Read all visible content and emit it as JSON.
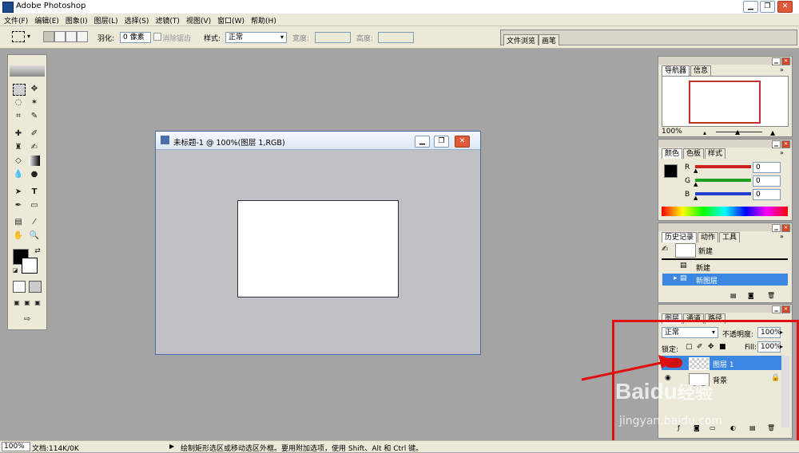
{
  "window": {
    "title": "Adobe Photoshop",
    "min": "▁",
    "max": "❐",
    "close": "✕"
  },
  "menu": [
    "文件(F)",
    "编辑(E)",
    "图象(I)",
    "图层(L)",
    "选择(S)",
    "滤镜(T)",
    "视图(V)",
    "窗口(W)",
    "帮助(H)"
  ],
  "options": {
    "feather_label": "羽化:",
    "feather_value": "0 像素",
    "antialias_label": "消除锯齿",
    "style_label": "样式:",
    "style_value": "正常",
    "width_label": "宽度:",
    "height_label": "高度:"
  },
  "palette_well": {
    "tabs": [
      "文件浏览",
      "画笔"
    ]
  },
  "document": {
    "title": "未标题-1 @ 100%(图层 1,RGB)"
  },
  "navigator": {
    "tabs": [
      "导航器",
      "信息"
    ],
    "zoom": "100%"
  },
  "color": {
    "tabs": [
      "颜色",
      "色板",
      "样式"
    ],
    "channels": [
      {
        "label": "R",
        "value": "0",
        "color": "#d02020"
      },
      {
        "label": "G",
        "value": "0",
        "color": "#20a020"
      },
      {
        "label": "B",
        "value": "0",
        "color": "#2040d0"
      }
    ]
  },
  "history": {
    "tabs": [
      "历史记录",
      "动作",
      "工具"
    ],
    "snapshot": "新建",
    "items": [
      "新建",
      "新图层"
    ]
  },
  "layers": {
    "tabs": [
      "图层",
      "通道",
      "路径"
    ],
    "blend_mode": "正常",
    "opacity_label": "不透明度:",
    "opacity_value": "100%",
    "lock_label": "锁定:",
    "fill_label": "Fill:",
    "fill_value": "100%",
    "items": [
      {
        "name": "图层 1",
        "selected": true
      },
      {
        "name": "背景",
        "selected": false
      }
    ]
  },
  "watermark": {
    "brand": "Bai",
    "paw": "du",
    "cn": "经验",
    "url": "jingyan.baidu.com"
  },
  "status": {
    "zoom": "100%",
    "doc": "文档:114K/0K",
    "hint": "绘制矩形选区或移动选区外框。要用附加选项，使用 Shift、Alt 和 Ctrl 键。"
  },
  "colors": {
    "highlight": "#e01010",
    "selection": "#3a86e0",
    "background": "#a4a4a4"
  }
}
